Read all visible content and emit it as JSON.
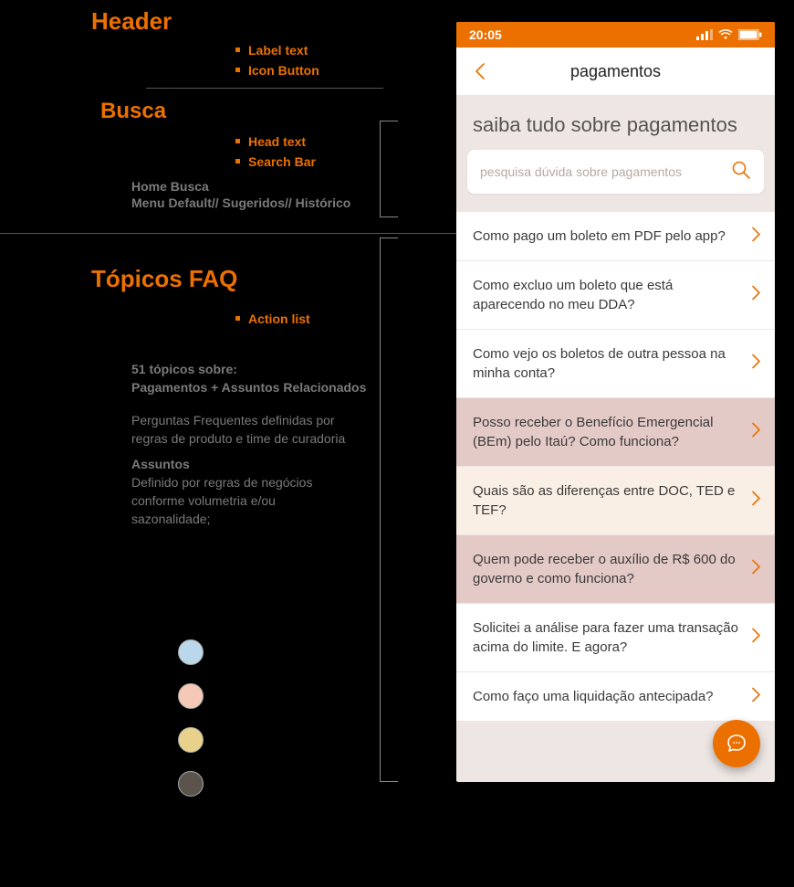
{
  "docs": {
    "header_title": "Header",
    "header_bullets": [
      "Label text",
      "Icon Button"
    ],
    "busca_title": "Busca",
    "busca_bullets": [
      "Head text",
      "Search Bar"
    ],
    "busca_note_line1": "Home Busca",
    "busca_note_line2": "Menu Default// Sugeridos// Histórico",
    "topicos_title": "Tópicos FAQ",
    "topicos_bullets": [
      "Action list"
    ],
    "topicos_block1_line1": "51 tópicos sobre:",
    "topicos_block1_line2": "Pagamentos + Assuntos Relacionados",
    "topicos_block2_line1": "Perguntas Frequentes definidas por",
    "topicos_block2_line2": "regras de produto e time de curadoria",
    "topicos_block3_line1": "Assuntos",
    "topicos_block3_line2": "Definido por regras de negócios",
    "topicos_block3_line3": "conforme volumetria e/ou",
    "topicos_block3_line4": "sazonalidade;",
    "swatch_colors": [
      "#BBD7EC",
      "#F6C9B7",
      "#E8D28B",
      "#5B544D"
    ]
  },
  "phone": {
    "status_time": "20:05",
    "nav_title": "pagamentos",
    "hero_title": "saiba tudo sobre pagamentos",
    "search_placeholder": "pesquisa dúvida sobre pagamentos",
    "faq": [
      {
        "text": "Como pago um boleto em PDF pelo app?",
        "variant": ""
      },
      {
        "text": "Como excluo um boleto que está aparecendo no meu DDA?",
        "variant": ""
      },
      {
        "text": "Como vejo os boletos de outra pessoa na minha conta?",
        "variant": ""
      },
      {
        "text": "Posso receber o Benefício Emergencial (BEm) pelo Itaú? Como funciona?",
        "variant": "alt1"
      },
      {
        "text": "Quais são as diferenças entre DOC, TED e TEF?",
        "variant": "alt2"
      },
      {
        "text": "Quem pode receber o auxílio de R$ 600 do governo e como funciona?",
        "variant": "alt1"
      },
      {
        "text": "Solicitei a análise para fazer uma transação acima do limite. E agora?",
        "variant": ""
      },
      {
        "text": "Como faço uma liquidação antecipada?",
        "variant": ""
      }
    ]
  },
  "colors": {
    "brand": "#EC7000"
  }
}
